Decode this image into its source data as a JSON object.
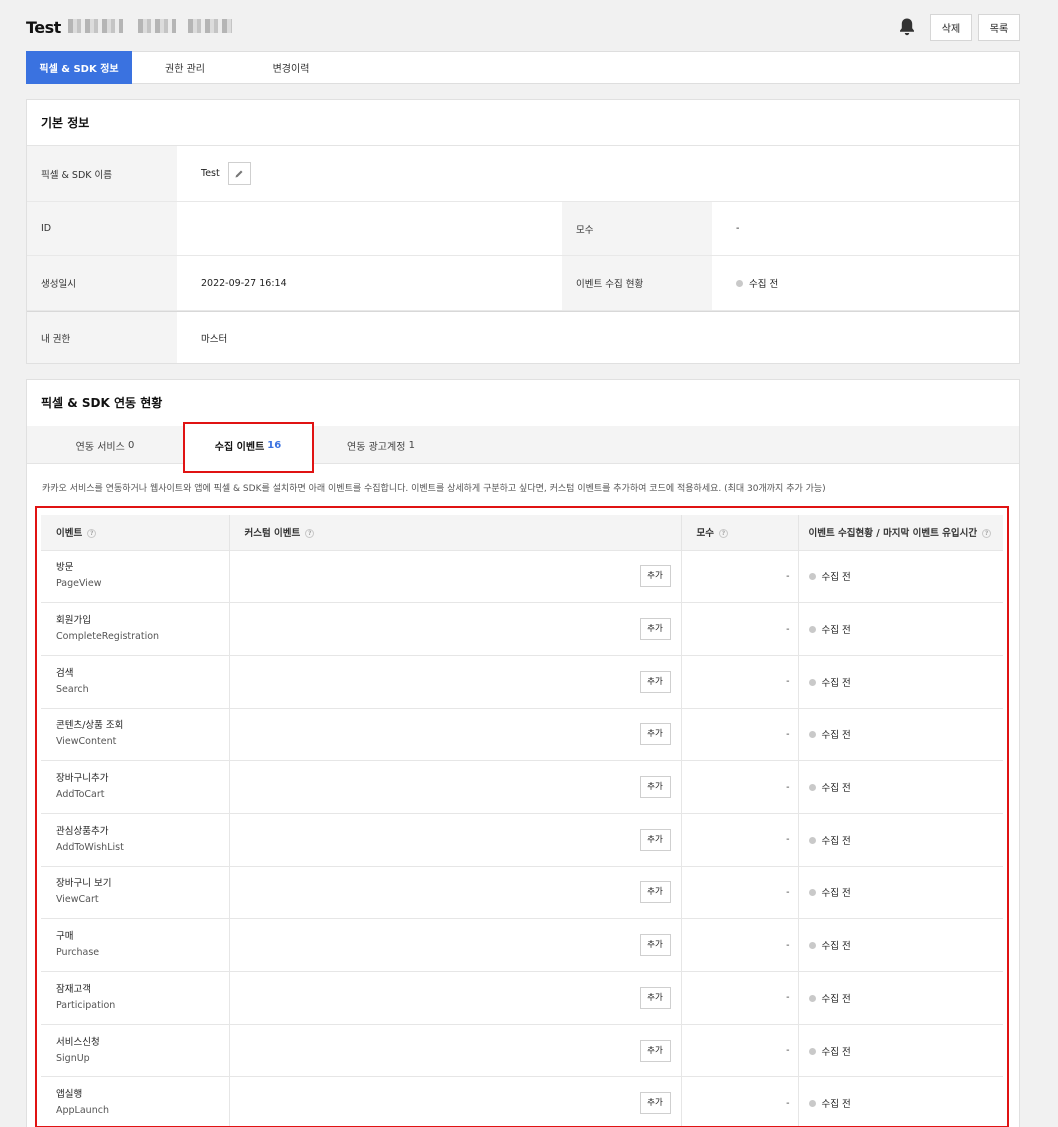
{
  "header": {
    "title": "Test",
    "delete_label": "삭제",
    "list_label": "목록"
  },
  "tabs": [
    {
      "label": "픽셀 & SDK 정보",
      "active": true
    },
    {
      "label": "권한 관리",
      "active": false
    },
    {
      "label": "변경이력",
      "active": false
    }
  ],
  "basic": {
    "title": "기본 정보",
    "name_label": "픽셀 & SDK 이름",
    "name_value": "Test",
    "id_label": "ID",
    "id_value": "",
    "pop_label": "모수",
    "pop_value": "-",
    "created_label": "생성일시",
    "created_value": "2022-09-27 16:14",
    "status_label": "이벤트 수집 현황",
    "status_value": "수집 전",
    "role_label": "내 권한",
    "role_value": "마스터"
  },
  "link": {
    "title": "픽셀 & SDK 연동 현황",
    "sub_tabs": [
      {
        "label": "연동 서비스",
        "count": "0"
      },
      {
        "label": "수집 이벤트",
        "count": "16"
      },
      {
        "label": "연동 광고계정",
        "count": "1"
      }
    ],
    "description": "카카오 서비스를 연동하거나 웹사이트와 앱에 픽셀 & SDK를 설치하면 아래 이벤트를 수집합니다. 이벤트를 상세하게 구분하고 싶다면, 커스텀 이벤트를 추가하여 코드에 적용하세요. (최대 30개까지 추가 가능)",
    "columns": [
      "이벤트",
      "커스텀 이벤트",
      "모수",
      "이벤트 수집현황 / 마지막 이벤트 유입시간"
    ],
    "add_label": "추가",
    "rows": [
      {
        "kr": "방문",
        "en": "PageView",
        "pop": "-",
        "status": "수집 전"
      },
      {
        "kr": "회원가입",
        "en": "CompleteRegistration",
        "pop": "-",
        "status": "수집 전"
      },
      {
        "kr": "검색",
        "en": "Search",
        "pop": "-",
        "status": "수집 전"
      },
      {
        "kr": "콘텐츠/상품 조회",
        "en": "ViewContent",
        "pop": "-",
        "status": "수집 전"
      },
      {
        "kr": "장바구니추가",
        "en": "AddToCart",
        "pop": "-",
        "status": "수집 전"
      },
      {
        "kr": "관심상품추가",
        "en": "AddToWishList",
        "pop": "-",
        "status": "수집 전"
      },
      {
        "kr": "장바구니 보기",
        "en": "ViewCart",
        "pop": "-",
        "status": "수집 전"
      },
      {
        "kr": "구매",
        "en": "Purchase",
        "pop": "-",
        "status": "수집 전"
      },
      {
        "kr": "잠재고객",
        "en": "Participation",
        "pop": "-",
        "status": "수집 전"
      },
      {
        "kr": "서비스신청",
        "en": "SignUp",
        "pop": "-",
        "status": "수집 전"
      },
      {
        "kr": "앱실행",
        "en": "AppLaunch",
        "pop": "-",
        "status": "수집 전"
      }
    ]
  },
  "colors": {
    "accent": "#3a72e0",
    "highlight": "#e01313",
    "status_dot": "#c9c9c9"
  },
  "icons": [
    "bell-icon",
    "pencil-icon",
    "help-icon",
    "status-dot-icon"
  ]
}
